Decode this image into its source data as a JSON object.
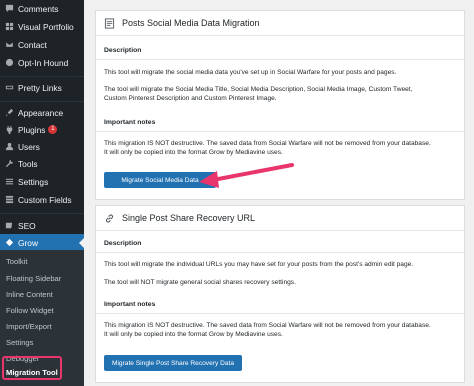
{
  "sidebar": {
    "items": [
      {
        "label": "Comments",
        "icon": "comments-icon"
      },
      {
        "label": "Visual Portfolio",
        "icon": "portfolio-icon"
      },
      {
        "label": "Contact",
        "icon": "envelope-icon"
      },
      {
        "label": "Opt-In Hound",
        "icon": "optin-icon"
      },
      {
        "label": "Pretty Links",
        "icon": "link-icon"
      },
      {
        "label": "Appearance",
        "icon": "brush-icon"
      },
      {
        "label": "Plugins",
        "icon": "plugin-icon",
        "badge": "1"
      },
      {
        "label": "Users",
        "icon": "users-icon"
      },
      {
        "label": "Tools",
        "icon": "wrench-icon"
      },
      {
        "label": "Settings",
        "icon": "settings-icon"
      },
      {
        "label": "Custom Fields",
        "icon": "fields-icon"
      },
      {
        "label": "SEO",
        "icon": "seo-icon"
      },
      {
        "label": "Grow",
        "icon": "grow-icon"
      }
    ],
    "submenu": [
      "Toolkit",
      "Floating Sidebar",
      "Inline Content",
      "Follow Widget",
      "Import/Export",
      "Settings",
      "Debugger",
      "Migration Tool"
    ]
  },
  "card1": {
    "title": "Posts Social Media Data Migration",
    "description_heading": "Description",
    "desc1": "This tool will migrate the social media data you've set up in Social Warfare for your posts and pages.",
    "desc2a": "The tool will migrate the Social Media Title, Social Media Description, Social Media Image, Custom Tweet,",
    "desc2b": "Custom Pinterest Description and Custom Pinterest Image.",
    "notes_heading": "Important notes",
    "note1a": "This migration IS NOT destructive. The saved data from Social Warfare will not be removed from your database.",
    "note1b": "It will only be copied into the format Grow by Mediavine uses.",
    "button": "Migrate Social Media Data"
  },
  "card2": {
    "title": "Single Post Share Recovery URL",
    "description_heading": "Description",
    "desc1": "This tool will migrate the individual URLs you may have set for your posts from the post's admin edit page.",
    "desc2": "The tool will NOT migrate general social shares recovery settings.",
    "notes_heading": "Important notes",
    "note1a": "This migration IS NOT destructive. The saved data from Social Warfare will not be removed from your database.",
    "note1b": "It will only be copied into the format Grow by Mediavine uses.",
    "button": "Migrate Single Post Share Recovery Data"
  },
  "colors": {
    "sidebar_bg": "#1d2327",
    "accent": "#2271b1",
    "highlight": "#e8356b",
    "badge": "#d63638"
  }
}
